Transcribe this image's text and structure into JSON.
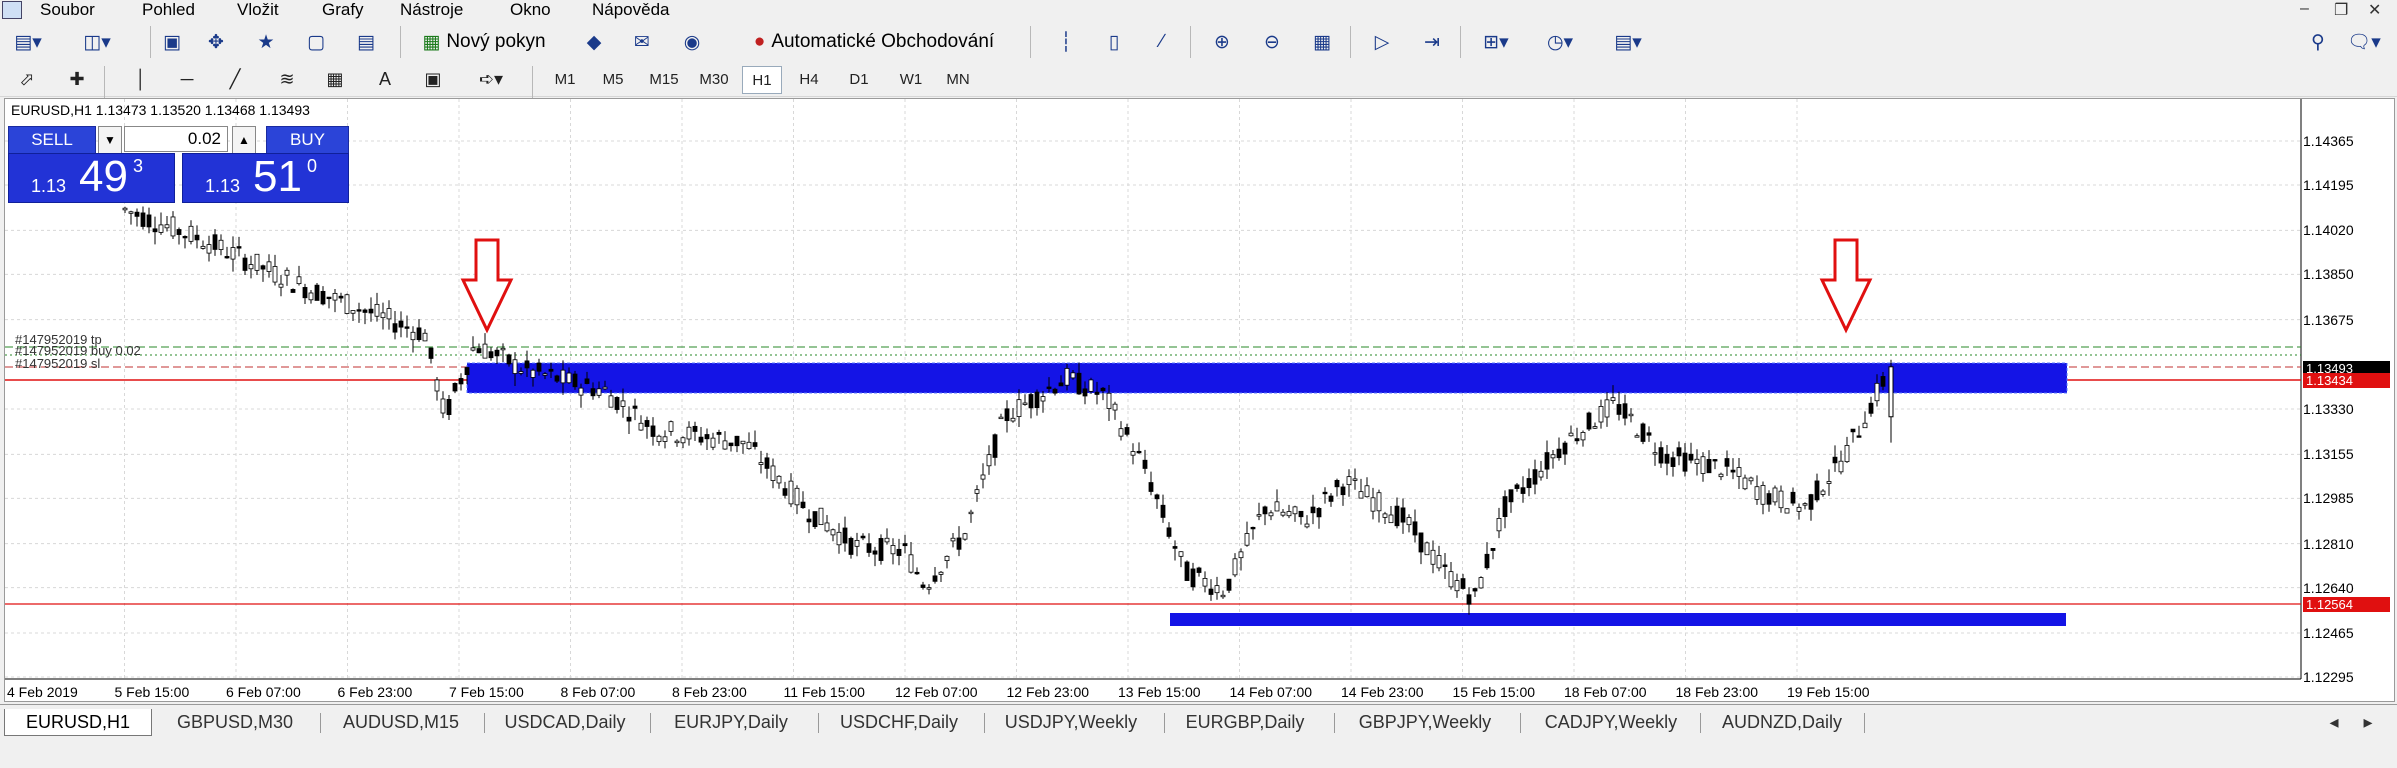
{
  "menu": {
    "items": [
      "Soubor",
      "Pohled",
      "Vložit",
      "Grafy",
      "Nástroje",
      "Okno",
      "Nápověda"
    ]
  },
  "toolbar": {
    "new_order_label": "Nový pokyn",
    "autotrading_label": "Automatické Obchodování",
    "timeframes": [
      "M1",
      "M5",
      "M15",
      "M30",
      "H1",
      "H4",
      "D1",
      "W1",
      "MN"
    ],
    "active_timeframe": "H1",
    "icons": [
      "new-chart-icon",
      "profiles-icon",
      "market-watch-icon",
      "navigator-icon",
      "favorites-icon",
      "data-window-icon",
      "strategy-tester-icon",
      "new-order-icon",
      "stats-icon",
      "email-icon",
      "signals-icon",
      "autotrading-icon",
      "bar-chart-icon",
      "candlestick-icon",
      "line-chart-icon",
      "zoom-in-icon",
      "zoom-out-icon",
      "tile-windows-icon",
      "autoscroll-icon",
      "chart-shift-icon",
      "indicators-icon",
      "periods-icon",
      "templates-icon",
      "search-icon",
      "chat-icon"
    ],
    "drawing_tools": [
      "cursor-icon",
      "crosshair-icon",
      "vertical-line-icon",
      "horizontal-line-icon",
      "trendline-icon",
      "fibonacci-icon",
      "gann-grid-icon",
      "text-icon",
      "text-label-icon",
      "arrows-icon"
    ]
  },
  "chart": {
    "title": "EURUSD,H1  1.13473 1.13520 1.13468 1.13493",
    "price_ticks": [
      "1.14365",
      "1.14195",
      "1.14020",
      "1.13850",
      "1.13675",
      "1.13330",
      "1.13155",
      "1.12985",
      "1.12810",
      "1.12640",
      "1.12465",
      "1.12295"
    ],
    "time_ticks": [
      "4 Feb 2019",
      "5 Feb 15:00",
      "6 Feb 07:00",
      "6 Feb 23:00",
      "7 Feb 15:00",
      "8 Feb 07:00",
      "8 Feb 23:00",
      "11 Feb 15:00",
      "12 Feb 07:00",
      "12 Feb 23:00",
      "13 Feb 15:00",
      "14 Feb 07:00",
      "14 Feb 23:00",
      "15 Feb 15:00",
      "18 Feb 07:00",
      "18 Feb 23:00",
      "19 Feb 15:00"
    ],
    "current_price_tag": "1.13493",
    "sl_price_tag": "1.13434",
    "red_level_tag": "1.12564",
    "order_labels": [
      "#147952019 tp",
      "#147952019 buy 0.02",
      "#147952019 sl"
    ],
    "colors": {
      "candle": "#000000",
      "zone": "#1414e6",
      "arrow": "#e01010",
      "tag_current": "#000000",
      "tag_red": "#e01010",
      "grid": "#d8d8d8"
    }
  },
  "trade_panel": {
    "sell_label": "SELL",
    "buy_label": "BUY",
    "lot_value": "0.02",
    "sell_prefix": "1.13",
    "sell_big": "49",
    "sell_sup": "3",
    "buy_prefix": "1.13",
    "buy_big": "51",
    "buy_sup": "0"
  },
  "tabs": [
    "EURUSD,H1",
    "GBPUSD,M30",
    "AUDUSD,M15",
    "USDCAD,Daily",
    "EURJPY,Daily",
    "USDCHF,Daily",
    "USDJPY,Weekly",
    "EURGBP,Daily",
    "GBPJPY,Weekly",
    "CADJPY,Weekly",
    "AUDNZD,Daily"
  ],
  "active_tab": "EURUSD,H1"
}
